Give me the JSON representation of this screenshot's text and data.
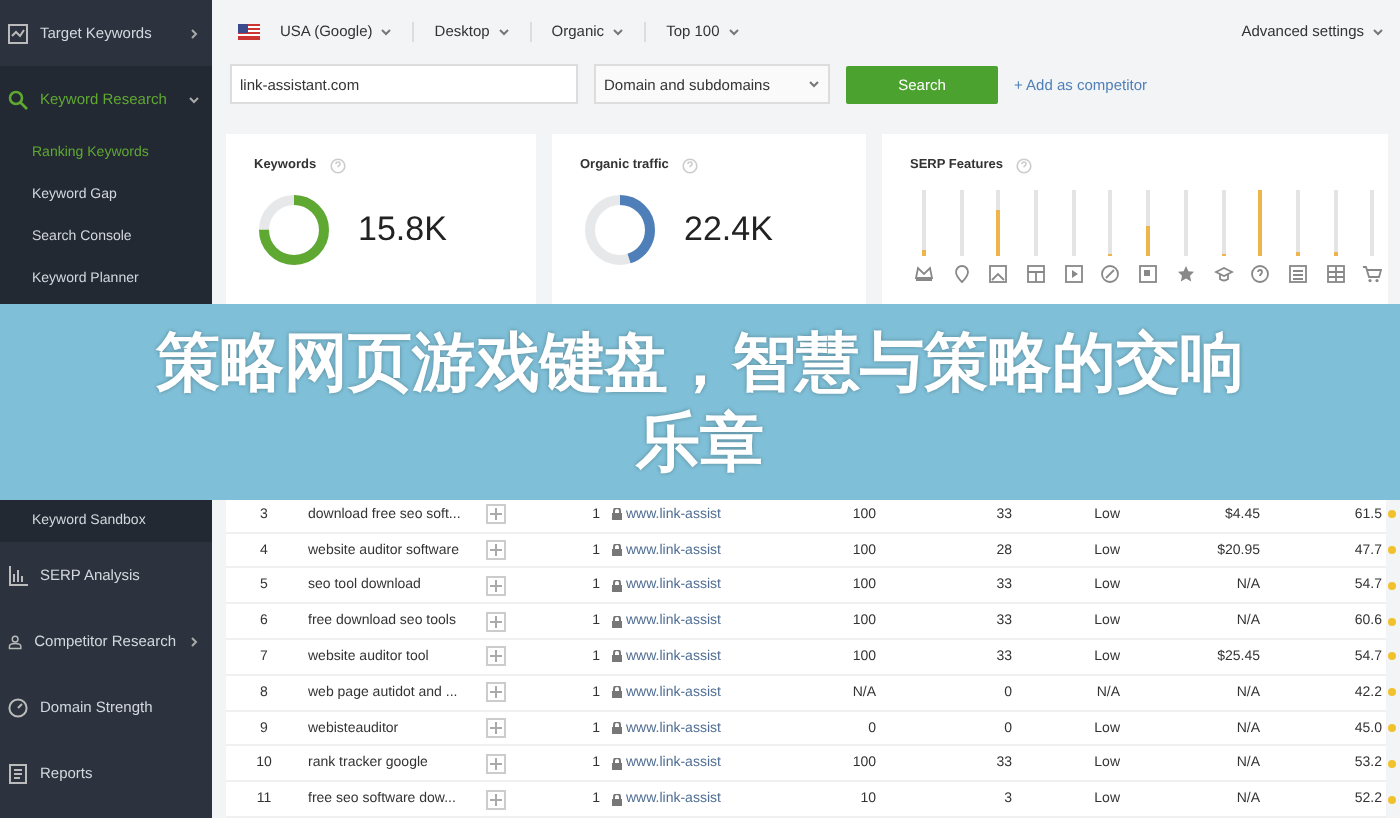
{
  "sidebar": {
    "items": [
      {
        "kind": "group",
        "label": "Target Keywords",
        "expanded": false,
        "selected": false
      },
      {
        "kind": "group",
        "label": "Keyword Research",
        "expanded": true,
        "selected": true,
        "children": [
          {
            "label": "Ranking Keywords",
            "selected": true
          },
          {
            "label": "Keyword Gap",
            "selected": false
          },
          {
            "label": "Search Console",
            "selected": false
          },
          {
            "label": "Keyword Planner",
            "selected": false
          },
          {
            "label": "Keyword Sandbox",
            "selected": false
          }
        ]
      },
      {
        "kind": "link",
        "label": "SERP Analysis",
        "selected": false
      },
      {
        "kind": "group",
        "label": "Competitor Research",
        "expanded": false,
        "selected": false
      },
      {
        "kind": "link",
        "label": "Domain Strength",
        "selected": false
      },
      {
        "kind": "link",
        "label": "Reports",
        "selected": false
      }
    ]
  },
  "filters": [
    "USA (Google)",
    "Desktop",
    "Organic",
    "Top 100"
  ],
  "advanced_settings": "Advanced settings",
  "search": {
    "value": "link-assistant.com",
    "scope": "Domain and subdomains",
    "button": "Search",
    "add_competitor": "+ Add as competitor"
  },
  "cards": [
    {
      "title": "Keywords",
      "value": "15.8K",
      "level": 0.75,
      "color": "#5fa832"
    },
    {
      "title": "Organic traffic",
      "value": "22.4K",
      "level": 0.45,
      "color": "#4f7fb8"
    }
  ],
  "serp_features": {
    "title": "SERP Features",
    "bars": [
      {
        "level": 0.08
      },
      {
        "level": 0
      },
      {
        "level": 0.7
      },
      {
        "level": 0
      },
      {
        "level": 0
      },
      {
        "level": 0.04
      },
      {
        "level": 0.45
      },
      {
        "level": 0
      },
      {
        "level": 0.04
      },
      {
        "level": 1
      },
      {
        "level": 0.05
      },
      {
        "level": 0.05
      },
      {
        "level": 0
      }
    ]
  },
  "table": {
    "rows": [
      [
        "3",
        "download free seo soft...",
        "1",
        "www.link-assist",
        "100",
        "33",
        "Low",
        "$4.45",
        "61.5"
      ],
      [
        "4",
        "website auditor software",
        "1",
        "www.link-assist",
        "100",
        "28",
        "Low",
        "$20.95",
        "47.7"
      ],
      [
        "5",
        "seo tool download",
        "1",
        "www.link-assist",
        "100",
        "33",
        "Low",
        "N/A",
        "54.7"
      ],
      [
        "6",
        "free download seo tools",
        "1",
        "www.link-assist",
        "100",
        "33",
        "Low",
        "N/A",
        "60.6"
      ],
      [
        "7",
        "website auditor tool",
        "1",
        "www.link-assist",
        "100",
        "33",
        "Low",
        "$25.45",
        "54.7"
      ],
      [
        "8",
        "web page autidot and ...",
        "1",
        "www.link-assist",
        "N/A",
        "0",
        "N/A",
        "N/A",
        "42.2"
      ],
      [
        "9",
        "webisteauditor",
        "1",
        "www.link-assist",
        "0",
        "0",
        "Low",
        "N/A",
        "45.0"
      ],
      [
        "10",
        "rank tracker google",
        "1",
        "www.link-assist",
        "100",
        "33",
        "Low",
        "N/A",
        "53.2"
      ],
      [
        "11",
        "free seo software dow...",
        "1",
        "www.link-assist",
        "10",
        "3",
        "Low",
        "N/A",
        "52.2"
      ]
    ]
  },
  "banner": "策略网页游戏键盘，智慧与策略的交响乐章"
}
